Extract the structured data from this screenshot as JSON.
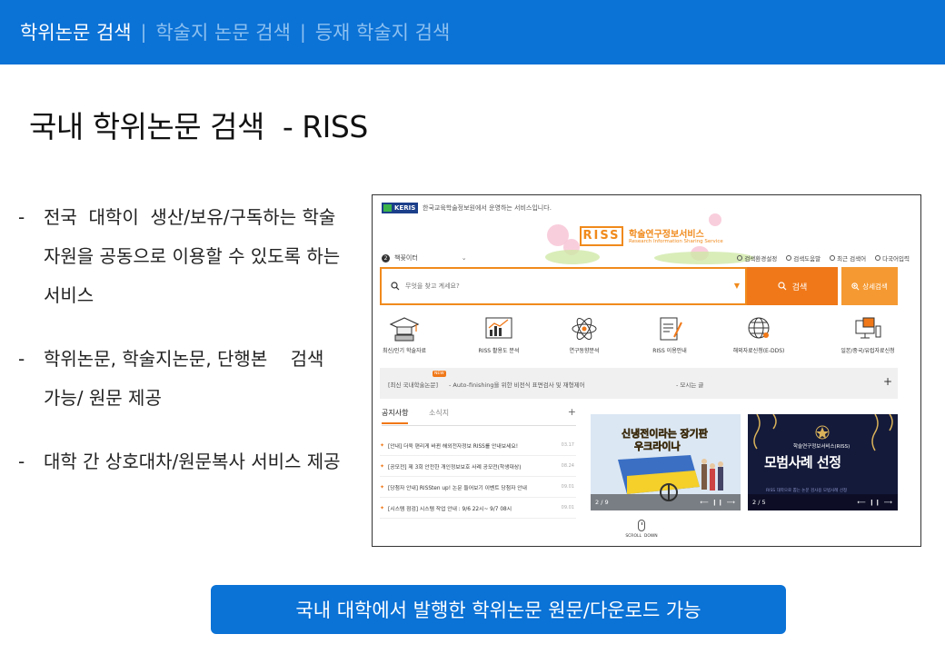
{
  "header": {
    "tabs": [
      {
        "label": "학위논문 검색",
        "active": true
      },
      {
        "label": "학술지 논문 검색",
        "active": false
      },
      {
        "label": "등재 학술지 검색",
        "active": false
      }
    ],
    "separator": "|"
  },
  "page_title": "국내 학위논문 검색  - RISS",
  "bullets": [
    {
      "dash": "-",
      "text": "전국  대학이  생산/보유/구독하는 학술자원을 공동으로 이용할 수 있도록 하는 서비스"
    },
    {
      "dash": "-",
      "text": "학위논문, 학술지논문, 단행본    검색 가능/ 원문 제공"
    },
    {
      "dash": "-",
      "text": "대학 간 상호대차/원문복사 서비스 제공"
    }
  ],
  "riss": {
    "keris_logo": "KERIS",
    "keris_text": "한국교육학술정보원에서 운영하는 서비스입니다.",
    "logo": "RISS",
    "service_name": "학술연구정보서비스",
    "service_sub": "Research Information Sharing Service",
    "library": {
      "num": "2",
      "label": "책꽂이터",
      "chevron": "⌄"
    },
    "util_links": [
      "검색환경설정",
      "검색도움말",
      "최근 검색어",
      "다국어입력"
    ],
    "search": {
      "placeholder": "무엇을 찾고 계세요?",
      "button": "검색",
      "advanced": "상세검색",
      "dropdown": "▼"
    },
    "services": [
      {
        "label": "최신/인기 학술자료",
        "icon": "graduation-cap-icon"
      },
      {
        "label": "RISS 활용도 분석",
        "icon": "analytics-chart-icon"
      },
      {
        "label": "연구동향분석",
        "icon": "atom-icon"
      },
      {
        "label": "RISS 이용안내",
        "icon": "document-pen-icon"
      },
      {
        "label": "해외자료신청(E-DDS)",
        "icon": "globe-icon"
      },
      {
        "label": "일본/중국/유럽자료신청",
        "icon": "monitor-icon"
      }
    ],
    "notice_bar": {
      "tag": "[최신 국내학술논문]",
      "new_badge": "NEW",
      "text1": "- Auto-finishing을 위한 비전식 표면검사 및 재형제어",
      "text2": "- 모시는 글",
      "plus": "+"
    },
    "notice_tabs": [
      "공지사항",
      "소식지"
    ],
    "notice_plus": "+",
    "notices": [
      {
        "text": "[안내] 더욱 편리게 바뀐 해외전자정보 RISS를 안내보세요!",
        "date": "03.17"
      },
      {
        "text": "[공모전] 제 3회 안전한 개인정보보호 사례 공모전(학생대상)",
        "date": "08.24"
      },
      {
        "text": "[당첨자 안내] RISSten up! 논문 들어보기 이벤트 당첨자 안내",
        "date": "09.01"
      },
      {
        "text": "[시스템 점검] 시스템 작업 안내 : 9/6 22시~ 9/7 08시",
        "date": "09.01"
      }
    ],
    "card1": {
      "line1": "신냉전이라는 장기판",
      "line2": "우크라이나",
      "page": "2 / 9",
      "controls": "⟵ ❙❙ ⟶"
    },
    "card2": {
      "subtitle": "학술연구정보서비스(RISS)",
      "title": "모범사례 선정",
      "caption": "RISS 대학으로 뽑는 논문 검사용 모범사례 선정",
      "page": "2 / 5",
      "controls": "⟵ ❙❙ ⟶"
    },
    "scroll_label": "SCROLL  DOWN"
  },
  "bottom_button": "국내 대학에서 발행한 학위논문 원문/다운로드 가능",
  "colors": {
    "primary": "#0b72d6",
    "riss_orange": "#f07818"
  }
}
